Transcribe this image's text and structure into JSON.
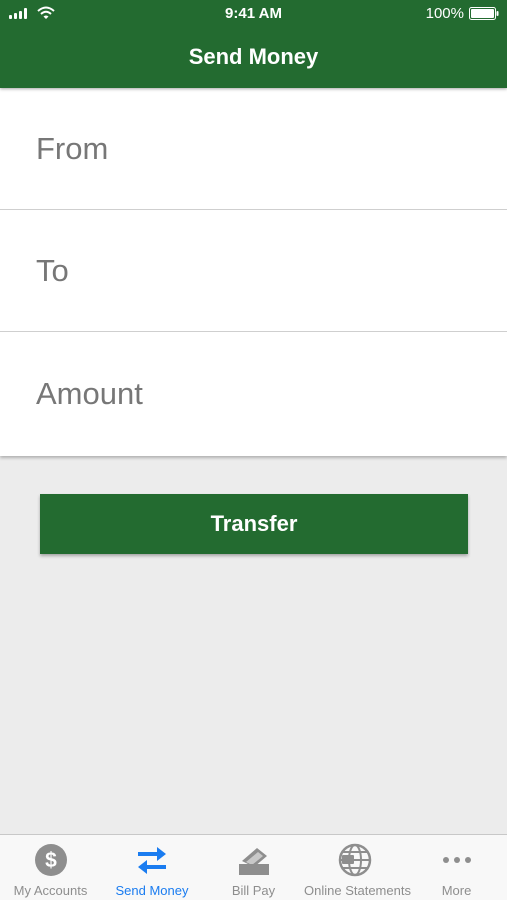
{
  "status_bar": {
    "time": "9:41 AM",
    "battery": "100%"
  },
  "header": {
    "title": "Send Money"
  },
  "form": {
    "fields": [
      {
        "placeholder": "From"
      },
      {
        "placeholder": "To"
      },
      {
        "placeholder": "Amount"
      }
    ]
  },
  "transfer_label": "Transfer",
  "tabbar": {
    "active_index": 1,
    "items": [
      {
        "label": "My Accounts",
        "icon": "dollar-coin-icon"
      },
      {
        "label": "Send Money",
        "icon": "transfer-arrows-icon"
      },
      {
        "label": "Bill Pay",
        "icon": "bill-pay-icon"
      },
      {
        "label": "Online Statements",
        "icon": "globe-icon"
      },
      {
        "label": "More",
        "icon": "more-dots-icon"
      }
    ]
  },
  "colors": {
    "brand_green": "#236b30",
    "active_tab": "#1a7cf0",
    "inactive_tab": "#8e8e8e"
  }
}
